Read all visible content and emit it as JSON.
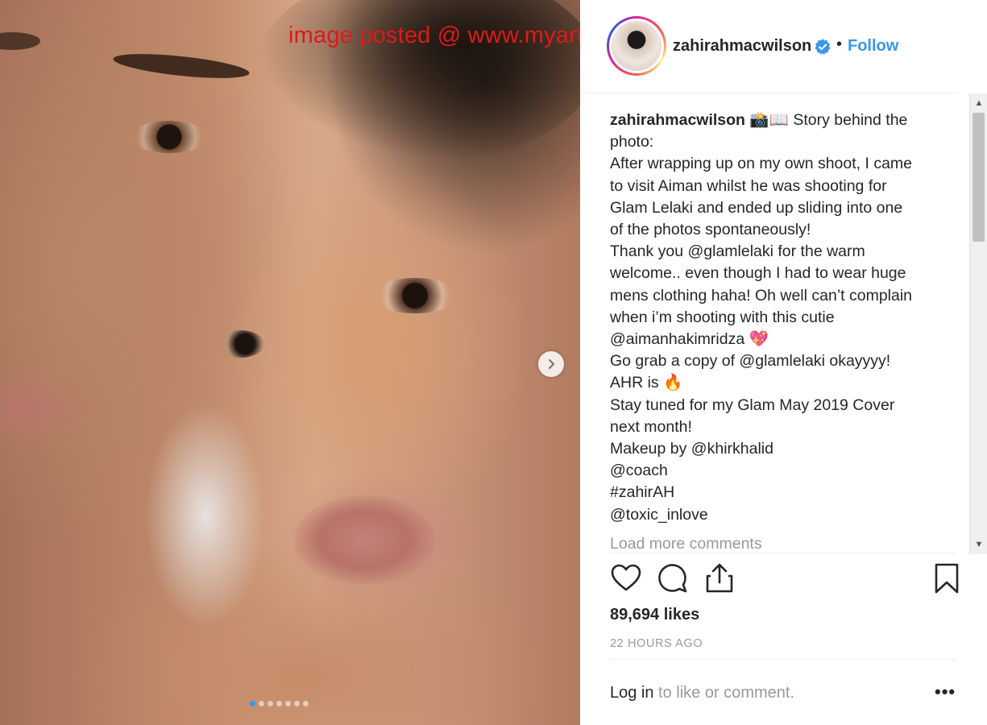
{
  "watermark": "image posted @ www.myartis.com",
  "post": {
    "username": "zahirahmacwilson",
    "follow_label": "Follow",
    "separator": "•",
    "carousel": {
      "slide_count": 7,
      "active_slide": 1
    }
  },
  "caption": {
    "username": "zahirahmacwilson",
    "emoji": "📸📖",
    "lines": [
      "Story behind the",
      "photo:",
      "After wrapping up on my own shoot, I came",
      "to visit Aiman whilst he was shooting for",
      "Glam Lelaki and ended up sliding into one",
      "of the photos spontaneously!",
      "Thank you @glamlelaki for the warm",
      "welcome.. even though I had to wear huge",
      "mens clothing haha! Oh well can’t complain",
      "when i’m shooting with this cutie",
      "@aimanhakimridza 💖",
      "Go grab a copy of @glamlelaki okayyyy!",
      "AHR is 🔥",
      "Stay tuned for my Glam May 2019 Cover",
      "next month!",
      "Makeup by @khirkhalid",
      "@coach",
      "#zahirAH",
      "@toxic_inlove"
    ]
  },
  "load_more": "Load more comments",
  "likes": "89,694 likes",
  "timestamp": "22 HOURS AGO",
  "login": {
    "link": "Log in",
    "rest": " to like or comment."
  },
  "more_options": "•••",
  "colors": {
    "accent": "#3897f0",
    "watermark": "#e11919",
    "muted": "#999999"
  },
  "icons": [
    "verified-icon",
    "heart-icon",
    "comment-icon",
    "share-icon",
    "bookmark-icon",
    "chevron-right-icon"
  ]
}
